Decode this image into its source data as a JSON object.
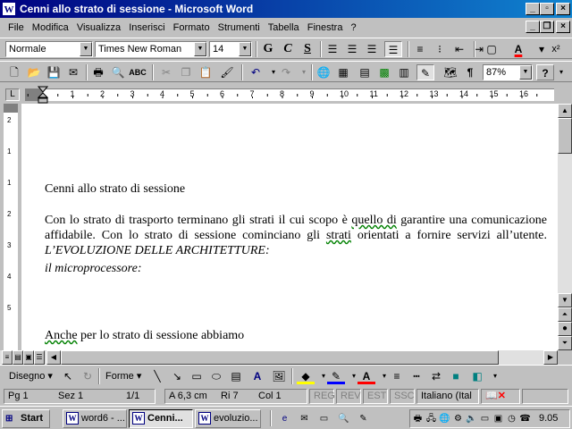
{
  "window": {
    "title": "Cenni allo strato di sessione - Microsoft Word"
  },
  "menu": [
    "File",
    "Modifica",
    "Visualizza",
    "Inserisci",
    "Formato",
    "Strumenti",
    "Tabella",
    "Finestra",
    "?"
  ],
  "format": {
    "style": "Normale",
    "font": "Times New Roman",
    "size": "14",
    "bold": "G",
    "italic": "C",
    "underline": "S"
  },
  "standard": {
    "zoom": "87%"
  },
  "ruler": {
    "numbers": [
      "1",
      "2",
      "3",
      "4",
      "5",
      "6",
      "7",
      "8",
      "9",
      "10",
      "11",
      "12",
      "13",
      "14",
      "15",
      "16"
    ]
  },
  "vruler": {
    "numbers": [
      "2",
      "1",
      "1",
      "2",
      "3",
      "4",
      "5"
    ]
  },
  "document": {
    "heading": "Cenni allo strato di sessione",
    "para1_a": "Con lo strato di trasporto terminano gli strati il cui scopo è ",
    "para1_b": "quello di",
    "para1_c": " garantire una comunicazione",
    "para1_d": "affidabile. Con lo strato di sessione cominciano gli ",
    "para1_e": "strati",
    "para1_f": " orientati a fornire servizi all’utente.",
    "italic1": "L’EVOLUZIONE DELLE ARCHITETTURE:",
    "italic2": "il microprocessore:",
    "para2_a": "Anche",
    "para2_b": " per lo strato di sessione abbiamo"
  },
  "drawing": {
    "draw_label": "Disegno",
    "shapes_label": "Forme"
  },
  "status": {
    "page": "Pg 1",
    "section": "Sez 1",
    "pages": "1/1",
    "at": "A 6,3 cm",
    "line": "Ri 7",
    "col": "Col 1",
    "rec": "REG",
    "rev": "REV",
    "ext": "EST",
    "ovr": "SSC",
    "lang": "Italiano (Ital"
  },
  "taskbar": {
    "start": "Start",
    "buttons": [
      "word6 - ...",
      "Cenni...",
      "evoluzio..."
    ],
    "clock": "9.05"
  },
  "colors": {
    "titlebar": "#000080",
    "face": "#c0c0c0",
    "highlight": "#ffff00",
    "fontcolor": "#ff0000"
  }
}
